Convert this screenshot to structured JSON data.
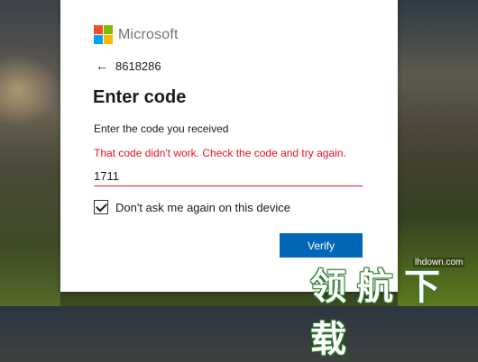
{
  "colors": {
    "brand_red": "#f25022",
    "brand_green": "#7fba00",
    "brand_blue": "#00a4ef",
    "brand_yellow": "#ffb900",
    "accent_button": "#0067b8",
    "error": "#e81123"
  },
  "header": {
    "logo_text": "Microsoft"
  },
  "identity": {
    "back_icon": "arrow-left-icon",
    "account": "8618286"
  },
  "form": {
    "title": "Enter code",
    "description": "Enter the code you received",
    "error_message": "That code didn't work. Check the code and try again.",
    "code_value": "1711",
    "remember_label": "Don't ask me again on this device",
    "remember_checked": true,
    "submit_label": "Verify"
  },
  "watermark": {
    "url": "lhdown.com",
    "text": "领航下载"
  }
}
